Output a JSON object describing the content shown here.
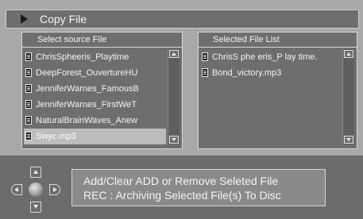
{
  "title": "Copy File",
  "source_panel": {
    "header": "Select source File",
    "items": [
      {
        "label": "ChrisSpheeris_Playtime",
        "selected": false
      },
      {
        "label": "DeepForest_OuvertureHU",
        "selected": false
      },
      {
        "label": "JenniferWarnes_FamousB",
        "selected": false
      },
      {
        "label": "JenniferWarnes_FirstWeT",
        "selected": false
      },
      {
        "label": "NaturalBrainWaves_Anew",
        "selected": false
      },
      {
        "label": "Swyc.mp3",
        "selected": true
      }
    ]
  },
  "selected_panel": {
    "header": "Selected  File  List",
    "items": [
      {
        "label": "ChrisS phe eris_P lay time."
      },
      {
        "label": "Bond_victory.mp3"
      }
    ]
  },
  "help": {
    "line1": "Add/Clear ADD  or  Remove  Seleted  File",
    "line2": "REC : Archiving Selected File(s) To Disc"
  },
  "colors": {
    "background": "#a8a8a8",
    "panel": "#6e6e6e",
    "selected_row": "#bcbcbc",
    "text": "#f4f4f4"
  },
  "icons": {
    "title": "play-triangle-icon",
    "file": "file-icon",
    "scroll_up": "scroll-up-arrow-icon",
    "scroll_down": "scroll-down-arrow-icon",
    "dpad": "dpad-navigation-icon"
  }
}
